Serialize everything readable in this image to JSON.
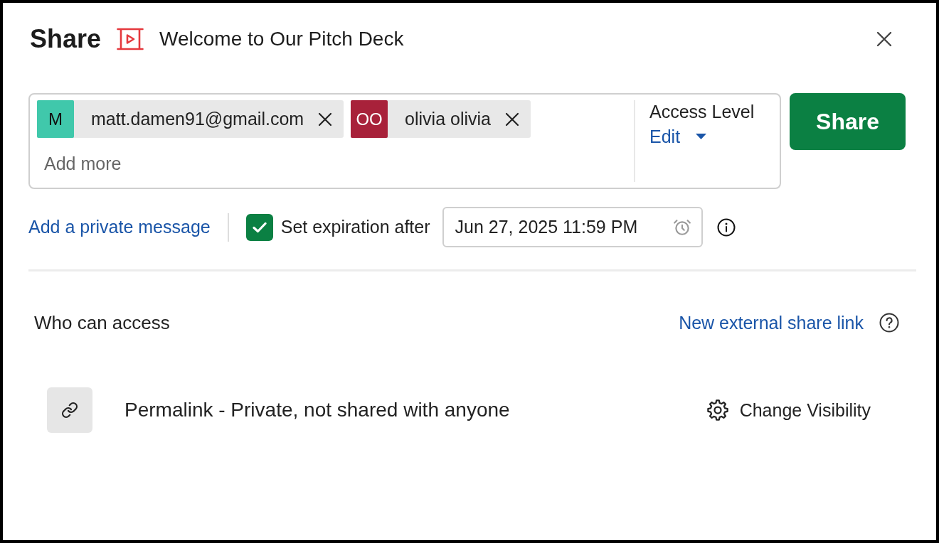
{
  "dialog": {
    "title": "Share",
    "file_name": "Welcome to Our Pitch Deck"
  },
  "recipients": [
    {
      "initials": "M",
      "label": "matt.damen91@gmail.com",
      "color": "#40c8ab"
    },
    {
      "initials": "OO",
      "label": "olivia olivia",
      "color": "#a8213a"
    }
  ],
  "recipient_input": {
    "placeholder": "Add more"
  },
  "access_level": {
    "label": "Access Level",
    "value": "Edit"
  },
  "share_button": {
    "label": "Share"
  },
  "private_message_link": "Add a private message",
  "expiration": {
    "label": "Set expiration after",
    "checked": true,
    "value": "Jun 27, 2025 11:59 PM"
  },
  "who_can_access": {
    "heading": "Who can access",
    "new_link": "New external share link"
  },
  "permalink": {
    "text": "Permalink - Private, not shared with anyone",
    "action": "Change Visibility"
  }
}
